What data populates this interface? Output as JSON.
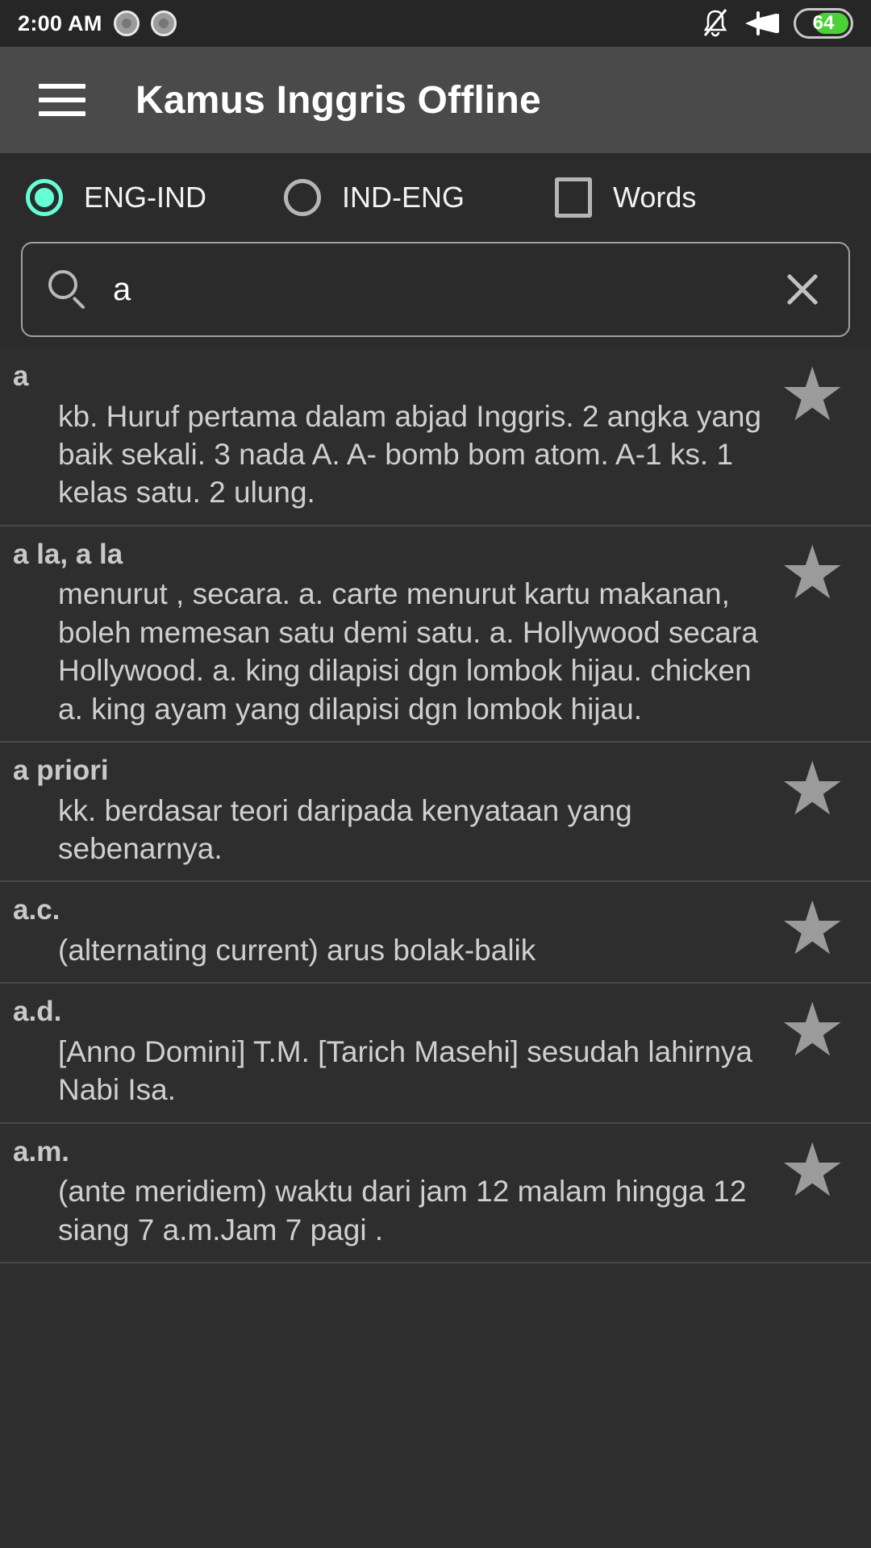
{
  "status_bar": {
    "time": "2:00 AM",
    "icons": [
      "record-dot-icon",
      "record-dot-icon",
      "bell-muted-icon",
      "airplane-mode-icon"
    ],
    "battery_percent": "64",
    "battery_color": "#4CD137"
  },
  "app_bar": {
    "menu_icon": "hamburger-menu-icon",
    "title": "Kamus Inggris Offline"
  },
  "options": {
    "accent_color": "#64FFD5",
    "items": [
      {
        "label": "ENG-IND",
        "type": "radio",
        "selected": true
      },
      {
        "label": "IND-ENG",
        "type": "radio",
        "selected": false
      },
      {
        "label": "Words",
        "type": "checkbox",
        "selected": false
      }
    ]
  },
  "search": {
    "icon": "search-icon",
    "value": "a",
    "placeholder": "",
    "clear_icon": "close-icon"
  },
  "results": {
    "entries": [
      {
        "word": "a",
        "definition": "kb. Huruf pertama dalam abjad Inggris. 2 angka yang baik sekali. 3 nada  A.   A- bomb bom atom.  A-1 ks. 1 kelas satu. 2 ulung.",
        "favorite_icon": "star-icon"
      },
      {
        "word": "a la, a la",
        "definition": "menurut , secara. a. carte menurut kartu makanan, boleh memesan satu demi satu. a. Hollywood secara Hollywood. a. king dilapisi dgn lombok hijau. chicken a. king ayam yang dilapisi dgn lombok hijau.",
        "favorite_icon": "star-icon"
      },
      {
        "word": "a priori",
        "definition": "kk. berdasar teori daripada kenyataan yang sebenarnya.",
        "favorite_icon": "star-icon"
      },
      {
        "word": "a.c.",
        "definition": "(alternating current) arus bolak-balik",
        "favorite_icon": "star-icon"
      },
      {
        "word": "a.d.",
        "definition": "[Anno Domini] T.M. [Tarich Masehi] sesudah lahirnya Nabi Isa.",
        "favorite_icon": "star-icon"
      },
      {
        "word": "a.m.",
        "definition": "(ante meridiem) waktu dari jam 12 malam hingga 12 siang 7 a.m.Jam 7 pagi .",
        "favorite_icon": "star-icon"
      }
    ],
    "star_glyph": "★"
  }
}
